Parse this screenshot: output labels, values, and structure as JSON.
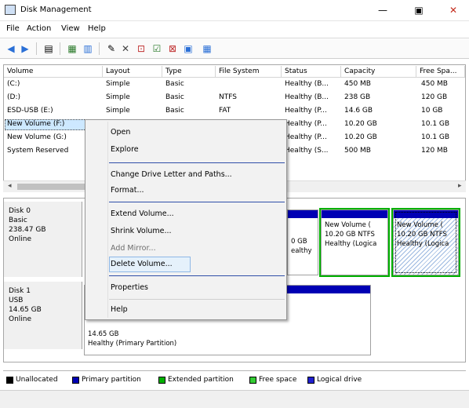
{
  "window": {
    "title": "Disk Management",
    "min": "—",
    "max": "▣",
    "close": "✕"
  },
  "menu": [
    "File",
    "Action",
    "View",
    "Help"
  ],
  "toolbar_icons": [
    "back-icon",
    "forward-icon",
    "list-icon",
    "properties-icon",
    "help-icon",
    "settings-icon",
    "delete-icon",
    "rescan-icon",
    "checkmark-icon",
    "format-icon",
    "refresh-icon"
  ],
  "columns": [
    "Volume",
    "Layout",
    "Type",
    "File System",
    "Status",
    "Capacity",
    "Free Spa..."
  ],
  "volumes": [
    {
      "volume": "(C:)",
      "layout": "Simple",
      "type": "Basic",
      "fs": "",
      "status": "Healthy (B...",
      "capacity": "450 MB",
      "free": "450 MB"
    },
    {
      "volume": "(D:)",
      "layout": "Simple",
      "type": "Basic",
      "fs": "NTFS",
      "status": "Healthy (B...",
      "capacity": "238 GB",
      "free": "120 GB"
    },
    {
      "volume": "ESD-USB (E:)",
      "layout": "Simple",
      "type": "Basic",
      "fs": "FAT",
      "status": "Healthy (P...",
      "capacity": "14.6 GB",
      "free": "10 GB"
    },
    {
      "volume": "New Volume (F:)",
      "layout": "Simple",
      "type": "Basic",
      "fs": "",
      "status": "Healthy (P...",
      "capacity": "10.20 GB",
      "free": "10.1 GB"
    },
    {
      "volume": "New Volume (G:)",
      "layout": "Simple",
      "type": "Basic",
      "fs": "",
      "status": "Healthy (P...",
      "capacity": "10.20 GB",
      "free": "10.1 GB"
    },
    {
      "volume": "System Reserved",
      "layout": "Simple",
      "type": "Basic",
      "fs": "",
      "status": "Healthy (S...",
      "capacity": "500 MB",
      "free": "120 MB"
    }
  ],
  "context_menu": [
    {
      "label": "Open",
      "disabled": false
    },
    {
      "label": "Explore",
      "disabled": false
    },
    {
      "label": "Change Drive Letter and Paths...",
      "disabled": false
    },
    {
      "label": "Format...",
      "disabled": false
    },
    {
      "label": "Extend Volume...",
      "disabled": false
    },
    {
      "label": "Shrink Volume...",
      "disabled": false
    },
    {
      "label": "Add Mirror...",
      "disabled": true
    },
    {
      "label": "Delete Volume...",
      "disabled": false
    },
    {
      "label": "Properties",
      "disabled": false
    },
    {
      "label": "Help",
      "disabled": false
    }
  ],
  "disk0": {
    "name": "Disk 0",
    "type": "Basic",
    "size": "238.47 GB",
    "status": "Online"
  },
  "disk1": {
    "name": "Disk 1",
    "type": "USB",
    "size": "14.65 GB",
    "status": "Online"
  },
  "disk0_partial": {
    "size_frag": "0 GB",
    "status_frag": "ealthy"
  },
  "disk0_parts": [
    {
      "name": "New Volume (",
      "size": "10.20 GB NTFS",
      "status": "Healthy (Logica"
    },
    {
      "name": "New Volume (",
      "size": "10.20 GB NTFS",
      "status": "Healthy (Logica"
    }
  ],
  "disk1_part": {
    "size": "14.65 GB",
    "status": "Healthy (Primary Partition)"
  },
  "legend": [
    "Unallocated",
    "Primary partition",
    "Extended partition",
    "Free space",
    "Logical drive"
  ],
  "colors": {
    "primary": "#0000b4",
    "extended": "#00b000",
    "free": "#33cc33",
    "logical": "#2020d0",
    "unallocated": "#000000"
  }
}
